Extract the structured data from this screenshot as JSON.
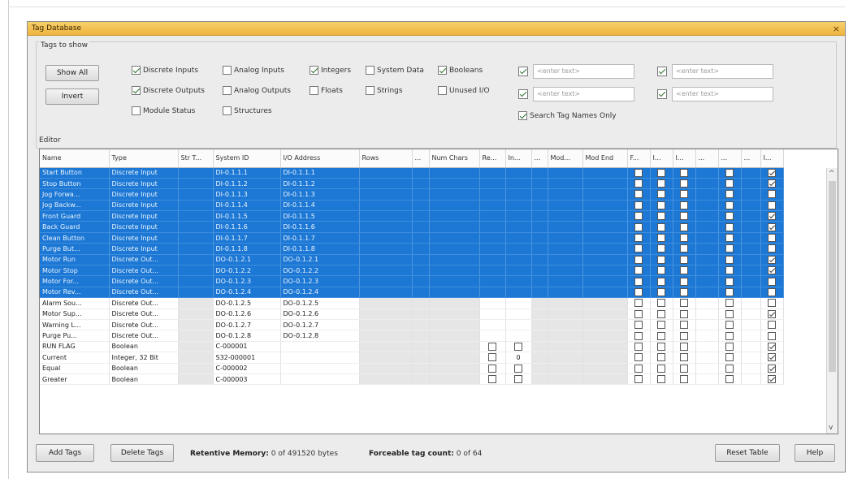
{
  "window": {
    "title": "Tag Database",
    "close_glyph": "×"
  },
  "tags_to_show": {
    "label": "Tags to show",
    "show_all": "Show All",
    "invert": "Invert",
    "filters": [
      {
        "label": "Discrete Inputs",
        "checked": true
      },
      {
        "label": "Discrete Outputs",
        "checked": true
      },
      {
        "label": "Module Status",
        "checked": false
      },
      {
        "label": "Analog Inputs",
        "checked": false
      },
      {
        "label": "Analog Outputs",
        "checked": false
      },
      {
        "label": "Structures",
        "checked": false
      },
      {
        "label": "Integers",
        "checked": true
      },
      {
        "label": "Floats",
        "checked": false
      },
      {
        "label": "System Data",
        "checked": false
      },
      {
        "label": "Strings",
        "checked": false
      },
      {
        "label": "Booleans",
        "checked": true
      },
      {
        "label": "Unused I/O",
        "checked": false
      }
    ],
    "search": {
      "placeholder": "<enter text>",
      "names_only": "Search Tag Names Only"
    }
  },
  "editor": {
    "label": "Editor",
    "columns": [
      "Name",
      "Type",
      "Str T...",
      "System ID",
      "I/O Address",
      "Rows",
      "...",
      "Num Chars",
      "Re...",
      "In...",
      "...",
      "Mod...",
      "Mod End",
      "F...",
      "I...",
      "I...",
      "...",
      "...",
      "...",
      "I..."
    ],
    "rows": [
      {
        "name": "Start Button",
        "type": "Discrete Input",
        "sysid": "DI-0.1.1.1",
        "io": "DI-0.1.1.1",
        "selected": true,
        "last": true
      },
      {
        "name": "Stop Button",
        "type": "Discrete Input",
        "sysid": "DI-0.1.1.2",
        "io": "DI-0.1.1.2",
        "selected": true,
        "last": true
      },
      {
        "name": "Jog Forwa...",
        "type": "Discrete Input",
        "sysid": "DI-0.1.1.3",
        "io": "DI-0.1.1.3",
        "selected": true,
        "last": false
      },
      {
        "name": "Jog Backw...",
        "type": "Discrete Input",
        "sysid": "DI-0.1.1.4",
        "io": "DI-0.1.1.4",
        "selected": true,
        "last": false
      },
      {
        "name": "Front Guard",
        "type": "Discrete Input",
        "sysid": "DI-0.1.1.5",
        "io": "DI-0.1.1.5",
        "selected": true,
        "last": true
      },
      {
        "name": "Back Guard",
        "type": "Discrete Input",
        "sysid": "DI-0.1.1.6",
        "io": "DI-0.1.1.6",
        "selected": true,
        "last": true
      },
      {
        "name": "Clean Button",
        "type": "Discrete Input",
        "sysid": "DI-0.1.1.7",
        "io": "DI-0.1.1.7",
        "selected": true,
        "last": false
      },
      {
        "name": "Purge But...",
        "type": "Discrete Input",
        "sysid": "DI-0.1.1.8",
        "io": "DI-0.1.1.8",
        "selected": true,
        "last": false
      },
      {
        "name": "Motor Run",
        "type": "Discrete Out...",
        "sysid": "DO-0.1.2.1",
        "io": "DO-0.1.2.1",
        "selected": true,
        "last": true
      },
      {
        "name": "Motor Stop",
        "type": "Discrete Out...",
        "sysid": "DO-0.1.2.2",
        "io": "DO-0.1.2.2",
        "selected": true,
        "last": true
      },
      {
        "name": "Motor For...",
        "type": "Discrete Out...",
        "sysid": "DO-0.1.2.3",
        "io": "DO-0.1.2.3",
        "selected": true,
        "last": false
      },
      {
        "name": "Motor Rev...",
        "type": "Discrete Out...",
        "sysid": "DO-0.1.2.4",
        "io": "DO-0.1.2.4",
        "selected": true,
        "last": false
      },
      {
        "name": "Alarm Sou...",
        "type": "Discrete Out...",
        "sysid": "DO-0.1.2.5",
        "io": "DO-0.1.2.5",
        "selected": false,
        "last": false
      },
      {
        "name": "Motor Sup...",
        "type": "Discrete Out...",
        "sysid": "DO-0.1.2.6",
        "io": "DO-0.1.2.6",
        "selected": false,
        "last": true
      },
      {
        "name": "Warning L...",
        "type": "Discrete Out...",
        "sysid": "DO-0.1.2.7",
        "io": "DO-0.1.2.7",
        "selected": false,
        "last": false
      },
      {
        "name": "Purge Pu...",
        "type": "Discrete Out...",
        "sysid": "DO-0.1.2.8",
        "io": "DO-0.1.2.8",
        "selected": false,
        "last": false
      },
      {
        "name": "RUN FLAG",
        "type": "Boolean",
        "sysid": "C-000001",
        "io": "",
        "selected": false,
        "last": true,
        "bool": true
      },
      {
        "name": "Current",
        "type": "Integer, 32 Bit",
        "sysid": "S32-000001",
        "io": "",
        "selected": false,
        "last": true,
        "int": true
      },
      {
        "name": "Equal",
        "type": "Boolean",
        "sysid": "C-000002",
        "io": "",
        "selected": false,
        "last": true,
        "bool": true
      },
      {
        "name": "Greater",
        "type": "Boolean",
        "sysid": "C-000003",
        "io": "",
        "selected": false,
        "last": true,
        "bool": true
      }
    ]
  },
  "footer": {
    "add_tags": "Add Tags",
    "delete_tags": "Delete Tags",
    "retentive_label": "Retentive Memory:",
    "retentive_value": "0 of 491520 bytes",
    "forceable_label": "Forceable tag count:",
    "forceable_value": "0 of 64",
    "reset_table": "Reset Table",
    "help": "Help"
  }
}
